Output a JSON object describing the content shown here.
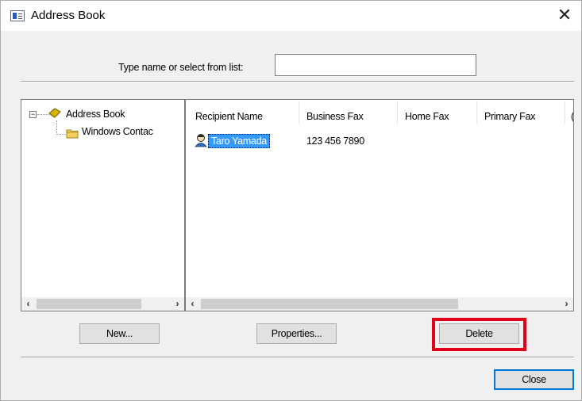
{
  "window": {
    "title": "Address Book",
    "close_glyph": "✕"
  },
  "search": {
    "label": "Type name or select from list:",
    "value": "",
    "placeholder": ""
  },
  "tree": {
    "expander": "⊟",
    "root": {
      "label": "Address Book",
      "icon": "address-book-icon"
    },
    "child": {
      "label": "Windows Contac",
      "icon": "folder-icon"
    }
  },
  "list": {
    "columns": [
      "Recipient Name",
      "Business Fax",
      "Home Fax",
      "Primary Fax",
      "("
    ],
    "rows": [
      {
        "recipient_name": "Taro Yamada",
        "business_fax": "123 456 7890",
        "home_fax": "",
        "primary_fax": "",
        "selected": true,
        "icon": "contact-icon"
      }
    ]
  },
  "scrollbars": {
    "left_arrow": "‹",
    "right_arrow": "›"
  },
  "buttons": {
    "new": "New...",
    "properties": "Properties...",
    "delete": "Delete",
    "close": "Close"
  },
  "colors": {
    "highlight": "#e0001a",
    "selection": "#3399ff"
  }
}
